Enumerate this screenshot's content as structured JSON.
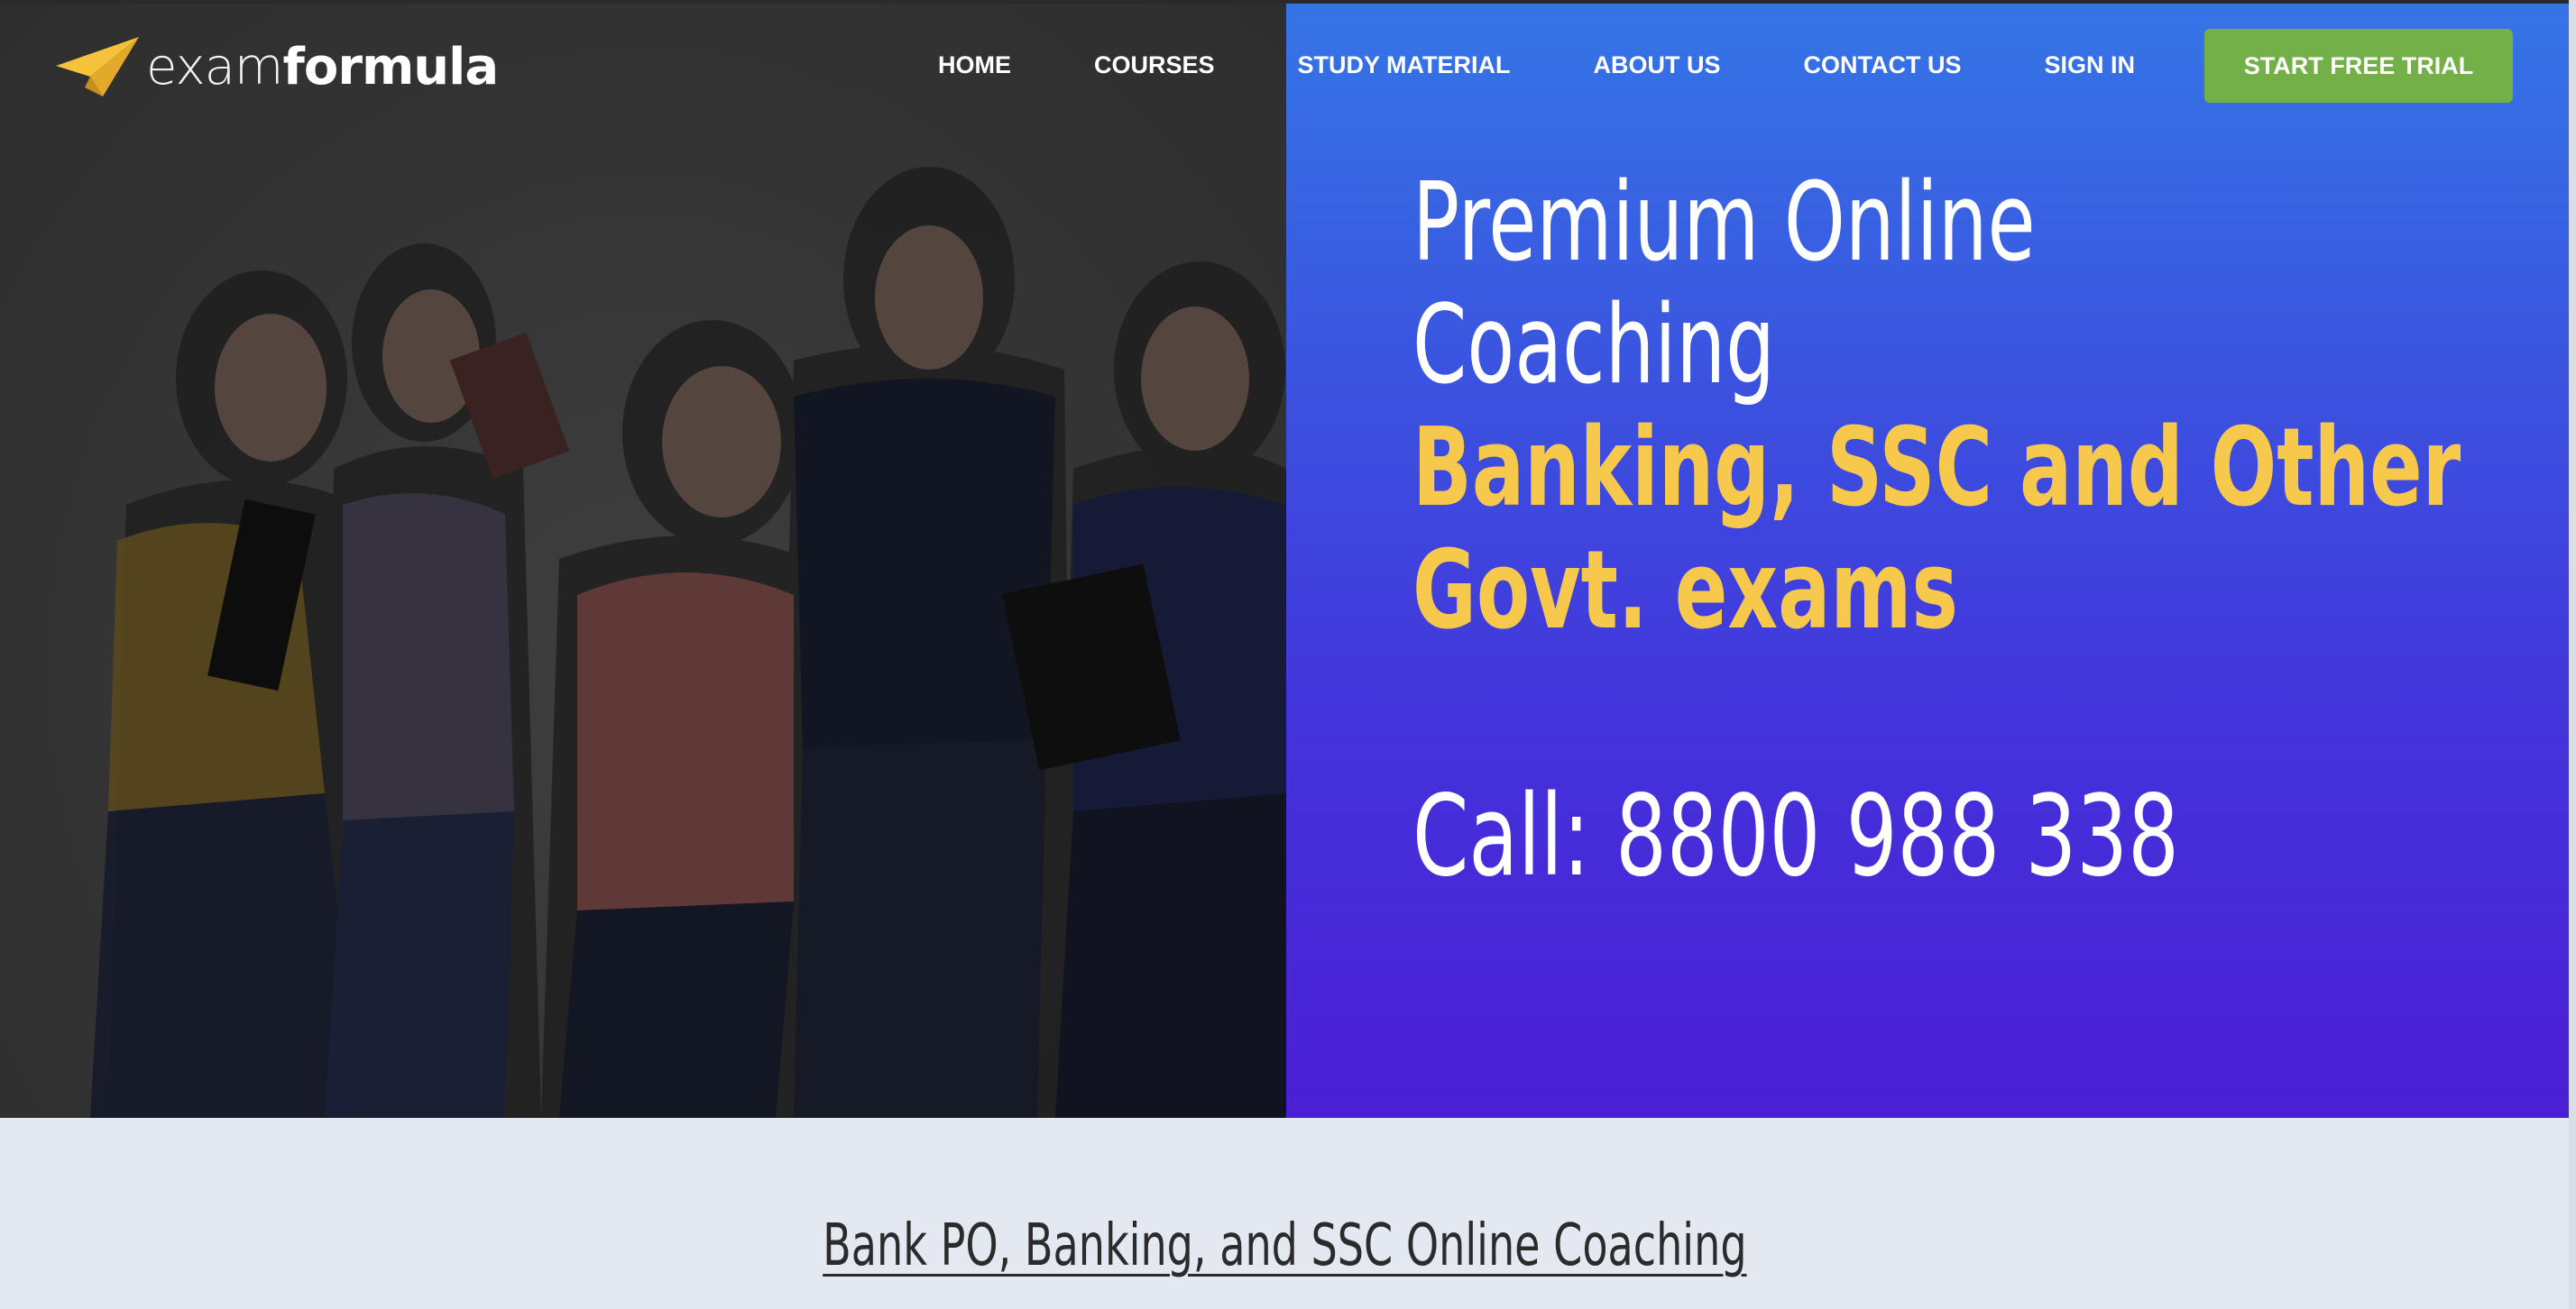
{
  "brand": {
    "logo_light": "exam",
    "logo_bold": "formula",
    "logo_icon": "paper-plane-icon",
    "accent_color": "#f6c84c"
  },
  "nav": {
    "items": [
      {
        "label": "HOME"
      },
      {
        "label": "COURSES"
      },
      {
        "label": "STUDY MATERIAL"
      },
      {
        "label": "ABOUT US"
      },
      {
        "label": "CONTACT US"
      },
      {
        "label": "SIGN IN"
      }
    ],
    "cta_label": "START FREE TRIAL",
    "cta_color": "#73b148"
  },
  "hero": {
    "line1": "Premium Online",
    "line2": "Coaching",
    "highlight1": "Banking, SSC and Other",
    "highlight2": "Govt. exams",
    "call": "Call: 8800 988 338",
    "panel_gradient": [
      "#3575e6",
      "#4b1fd6"
    ]
  },
  "section": {
    "title": "Bank PO, Banking, and SSC Online Coaching"
  }
}
